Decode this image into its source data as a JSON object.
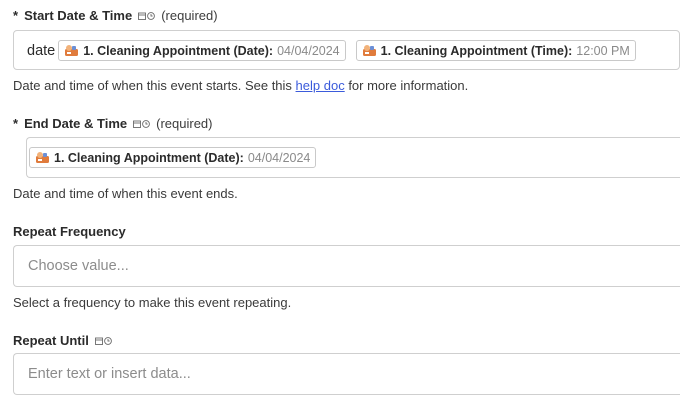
{
  "start": {
    "required_mark": "*",
    "label": "Start Date & Time",
    "required_text": "(required)",
    "field_text": "date",
    "pills": [
      {
        "title": "1. Cleaning Appointment (Date):",
        "value": "04/04/2024",
        "icon": "cleaning-app-icon"
      },
      {
        "title": "1. Cleaning Appointment (Time):",
        "value": "12:00 PM",
        "icon": "cleaning-app-icon"
      }
    ],
    "help_before": "Date and time of when this event starts. See this ",
    "help_link": "help doc",
    "help_after": " for more information."
  },
  "end": {
    "required_mark": "*",
    "label": "End Date & Time",
    "required_text": "(required)",
    "pills": [
      {
        "title": "1. Cleaning Appointment (Date):",
        "value": "04/04/2024",
        "icon": "cleaning-app-icon"
      }
    ],
    "help": "Date and time of when this event ends."
  },
  "repeat_frequency": {
    "label": "Repeat Frequency",
    "placeholder": "Choose value...",
    "help": "Select a frequency to make this event repeating."
  },
  "repeat_until": {
    "label": "Repeat Until",
    "placeholder": "Enter text or insert data..."
  },
  "colors": {
    "link": "#3b5bdb",
    "border": "#cfcfcf",
    "placeholder": "#8c8c8c",
    "pill_value": "#8a8a8a"
  },
  "icons": {
    "datetime_type": [
      "calendar-icon",
      "clock-icon"
    ]
  }
}
